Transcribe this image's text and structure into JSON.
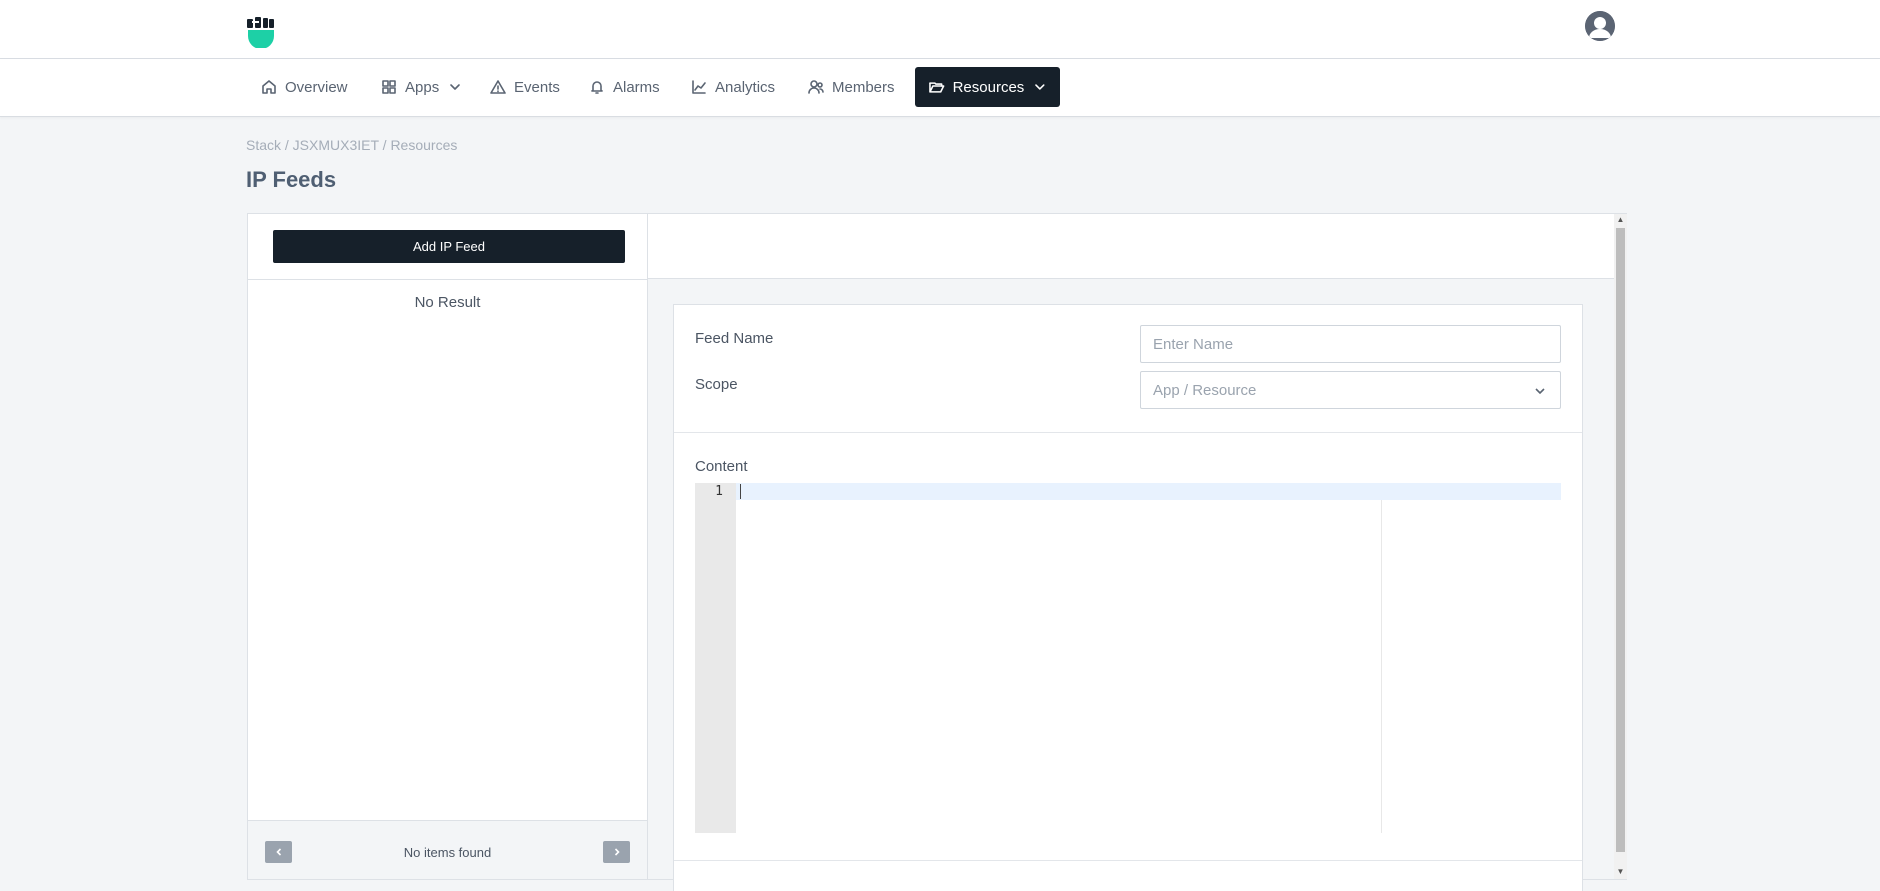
{
  "brand": {
    "logo_icon": "fist-shield-logo",
    "accent": "#1dd0a6",
    "dark": "#16202a"
  },
  "header": {
    "avatar_icon": "user-avatar-icon"
  },
  "nav": {
    "items": [
      {
        "label": "Overview",
        "icon": "home-icon"
      },
      {
        "label": "Apps",
        "icon": "grid-icon",
        "dropdown": true
      },
      {
        "label": "Events",
        "icon": "warning-triangle-icon"
      },
      {
        "label": "Alarms",
        "icon": "bell-icon"
      },
      {
        "label": "Analytics",
        "icon": "line-chart-icon"
      },
      {
        "label": "Members",
        "icon": "users-icon"
      },
      {
        "label": "Resources",
        "icon": "folder-open-icon",
        "dropdown": true,
        "active": true
      }
    ]
  },
  "breadcrumb": "Stack / JSXMUX3IET / Resources",
  "page": {
    "title": "IP Feeds"
  },
  "list": {
    "add_button": "Add IP Feed",
    "empty_text": "No Result",
    "pagination": {
      "label": "No items found",
      "prev_icon": "chevron-left-icon",
      "next_icon": "chevron-right-icon"
    }
  },
  "form": {
    "feed_name": {
      "label": "Feed Name",
      "placeholder": "Enter Name"
    },
    "scope": {
      "label": "Scope",
      "placeholder": "App / Resource"
    },
    "content": {
      "label": "Content",
      "line_number": "1"
    }
  }
}
